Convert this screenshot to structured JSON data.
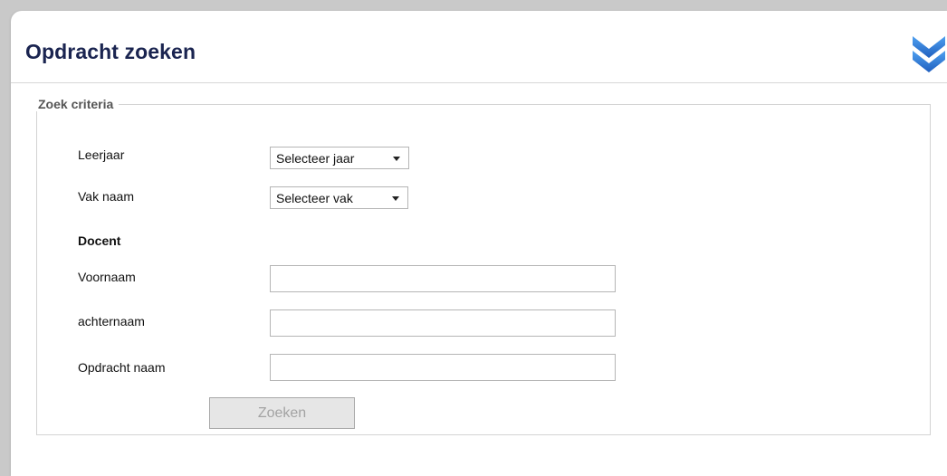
{
  "header": {
    "title": "Opdracht zoeken",
    "collapse_icon": "double-chevron-down-icon",
    "accent_color": "#2a6fcf"
  },
  "criteria": {
    "legend": "Zoek criteria",
    "leerjaar_label": "Leerjaar",
    "leerjaar_value": "Selecteer jaar",
    "vak_label": "Vak naam",
    "vak_value": "Selecteer vak",
    "docent_heading": "Docent",
    "voornaam_label": "Voornaam",
    "voornaam_value": "",
    "achternaam_label": "achternaam",
    "achternaam_value": "",
    "opdracht_label": "Opdracht naam",
    "opdracht_value": "",
    "search_button": "Zoeken"
  }
}
